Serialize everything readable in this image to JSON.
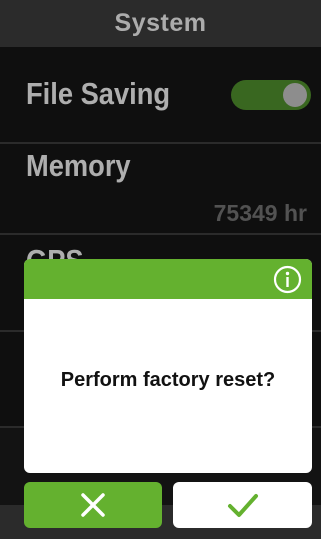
{
  "header": {
    "title": "System"
  },
  "list": {
    "items": [
      {
        "label": "File Saving",
        "toggle_on": true
      },
      {
        "label": "Memory",
        "value": "75349 hr"
      },
      {
        "label": "GPS"
      }
    ]
  },
  "dialog": {
    "message": "Perform factory reset?",
    "icon": "info-icon"
  },
  "buttons": {
    "cancel_icon": "close-icon",
    "confirm_icon": "check-icon"
  },
  "colors": {
    "accent": "#64b12f",
    "toggle": "#4d8a2b",
    "header": "#3a3a3a"
  }
}
